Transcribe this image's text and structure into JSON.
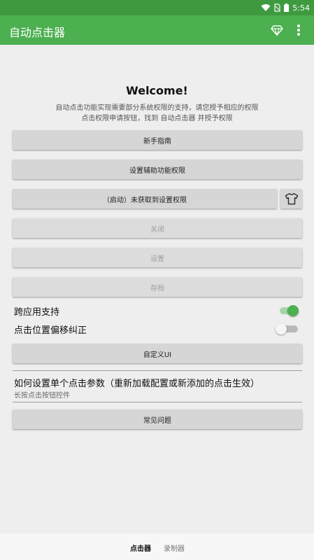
{
  "status_bar": {
    "time": "5:54"
  },
  "app_bar": {
    "title": "自动点击器",
    "actions": [
      "diamond-icon",
      "more-vert-icon"
    ]
  },
  "welcome": {
    "title": "Welcome!",
    "line1": "自动点击功能实现需要部分系统权限的支持，请您授予相应的权限",
    "line2": "点击权限申请按钮，找到 自动点击器 并授予权限"
  },
  "buttons": {
    "guide": "新手指南",
    "accessibility": "设置辅助功能权限",
    "start": "（启动）未获取到设置权限",
    "close": "关闭",
    "settings": "设置",
    "archive": "存档",
    "custom_ui": "自定义UI",
    "faq": "常见问题"
  },
  "toggles": [
    {
      "label": "跨应用支持",
      "on": true
    },
    {
      "label": "点击位置偏移纠正",
      "on": false
    }
  ],
  "howto": {
    "title": "如何设置单个点击参数（重新加载配置或新添加的点击生效）",
    "subtitle": "长按点击按钮控件"
  },
  "bottom_nav": {
    "active": "点击器",
    "inactive": "录制器"
  },
  "colors": {
    "primary": "#4caf50",
    "status_bar": "#3f9a3f",
    "switch_on": "#4caf50"
  }
}
